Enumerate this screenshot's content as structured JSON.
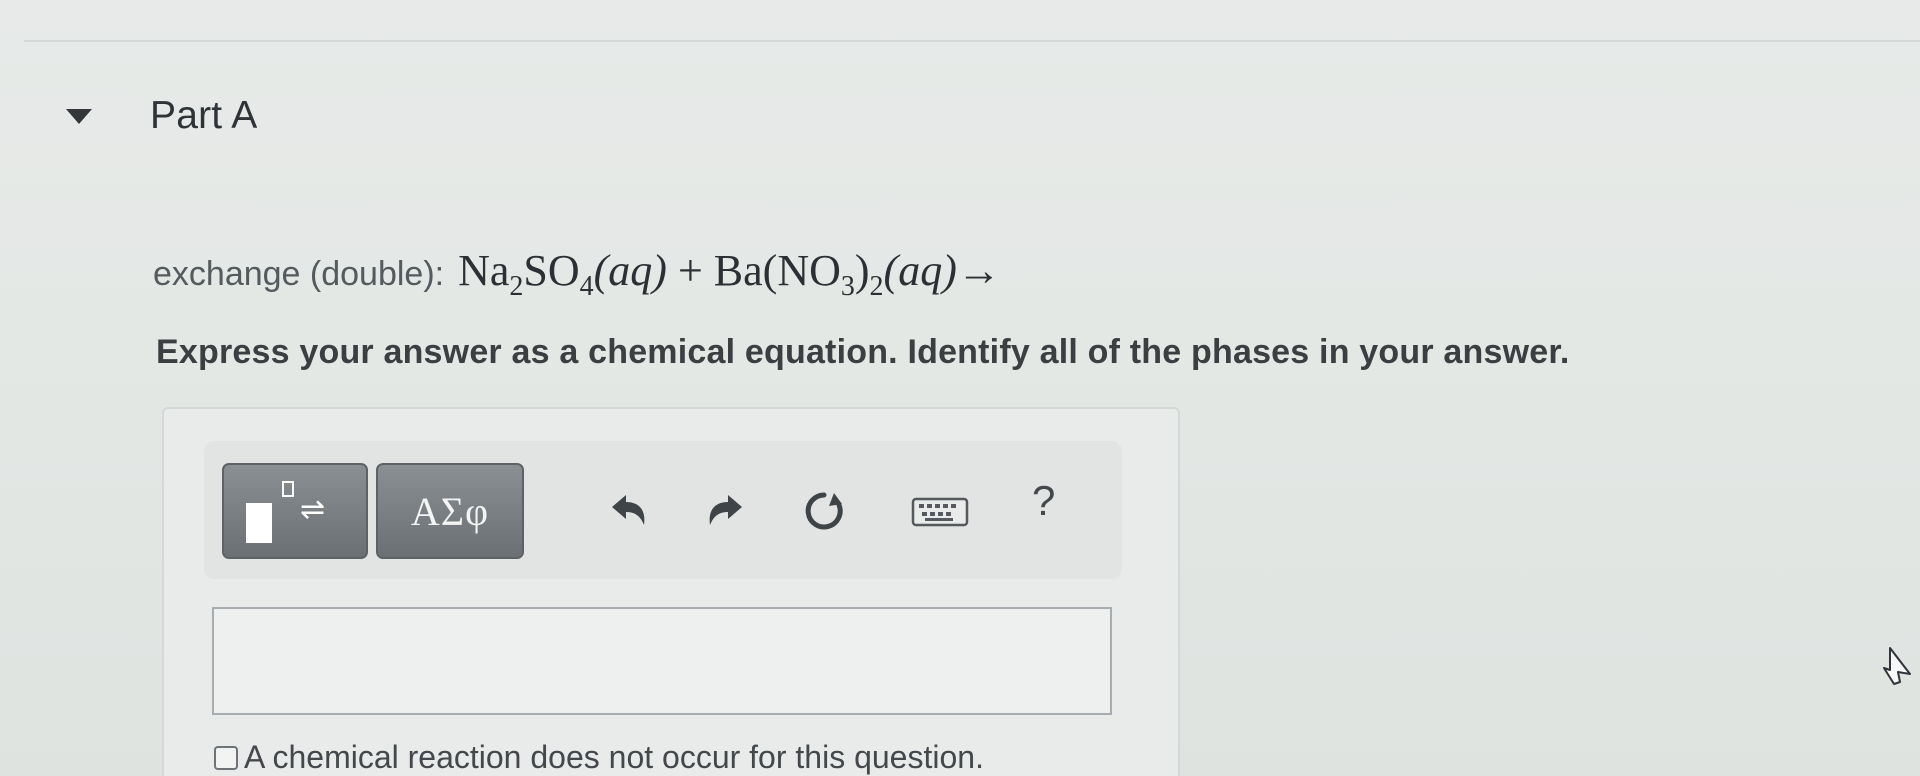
{
  "part": {
    "title": "Part A"
  },
  "question": {
    "prefix": "exchange (double):",
    "equation_parts": {
      "reactant1": "Na",
      "r1_sub1": "2",
      "r1_mid": "SO",
      "r1_sub2": "4",
      "r1_phase": "(aq)",
      "plus": " + ",
      "reactant2": "Ba(NO",
      "r2_sub1": "3",
      "r2_mid": ")",
      "r2_sub2": "2",
      "r2_phase": "(aq)",
      "arrow": "→"
    }
  },
  "instruction": "Express your answer as a chemical equation. Identify all of the phases in your answer.",
  "toolbar": {
    "templates_arrows": "⇌",
    "greek_label": "ΑΣφ",
    "help_label": "?",
    "icons": [
      "templates-icon",
      "undo-icon",
      "redo-icon",
      "reset-icon",
      "keyboard-icon",
      "help-icon"
    ]
  },
  "answer": {
    "value": "",
    "no_reaction_label": "A chemical reaction does not occur for this question.",
    "no_reaction_checked": false
  },
  "colors": {
    "background": "#e7eae8",
    "tool_button": "#7a7f83",
    "text_dark": "#2f3337"
  }
}
